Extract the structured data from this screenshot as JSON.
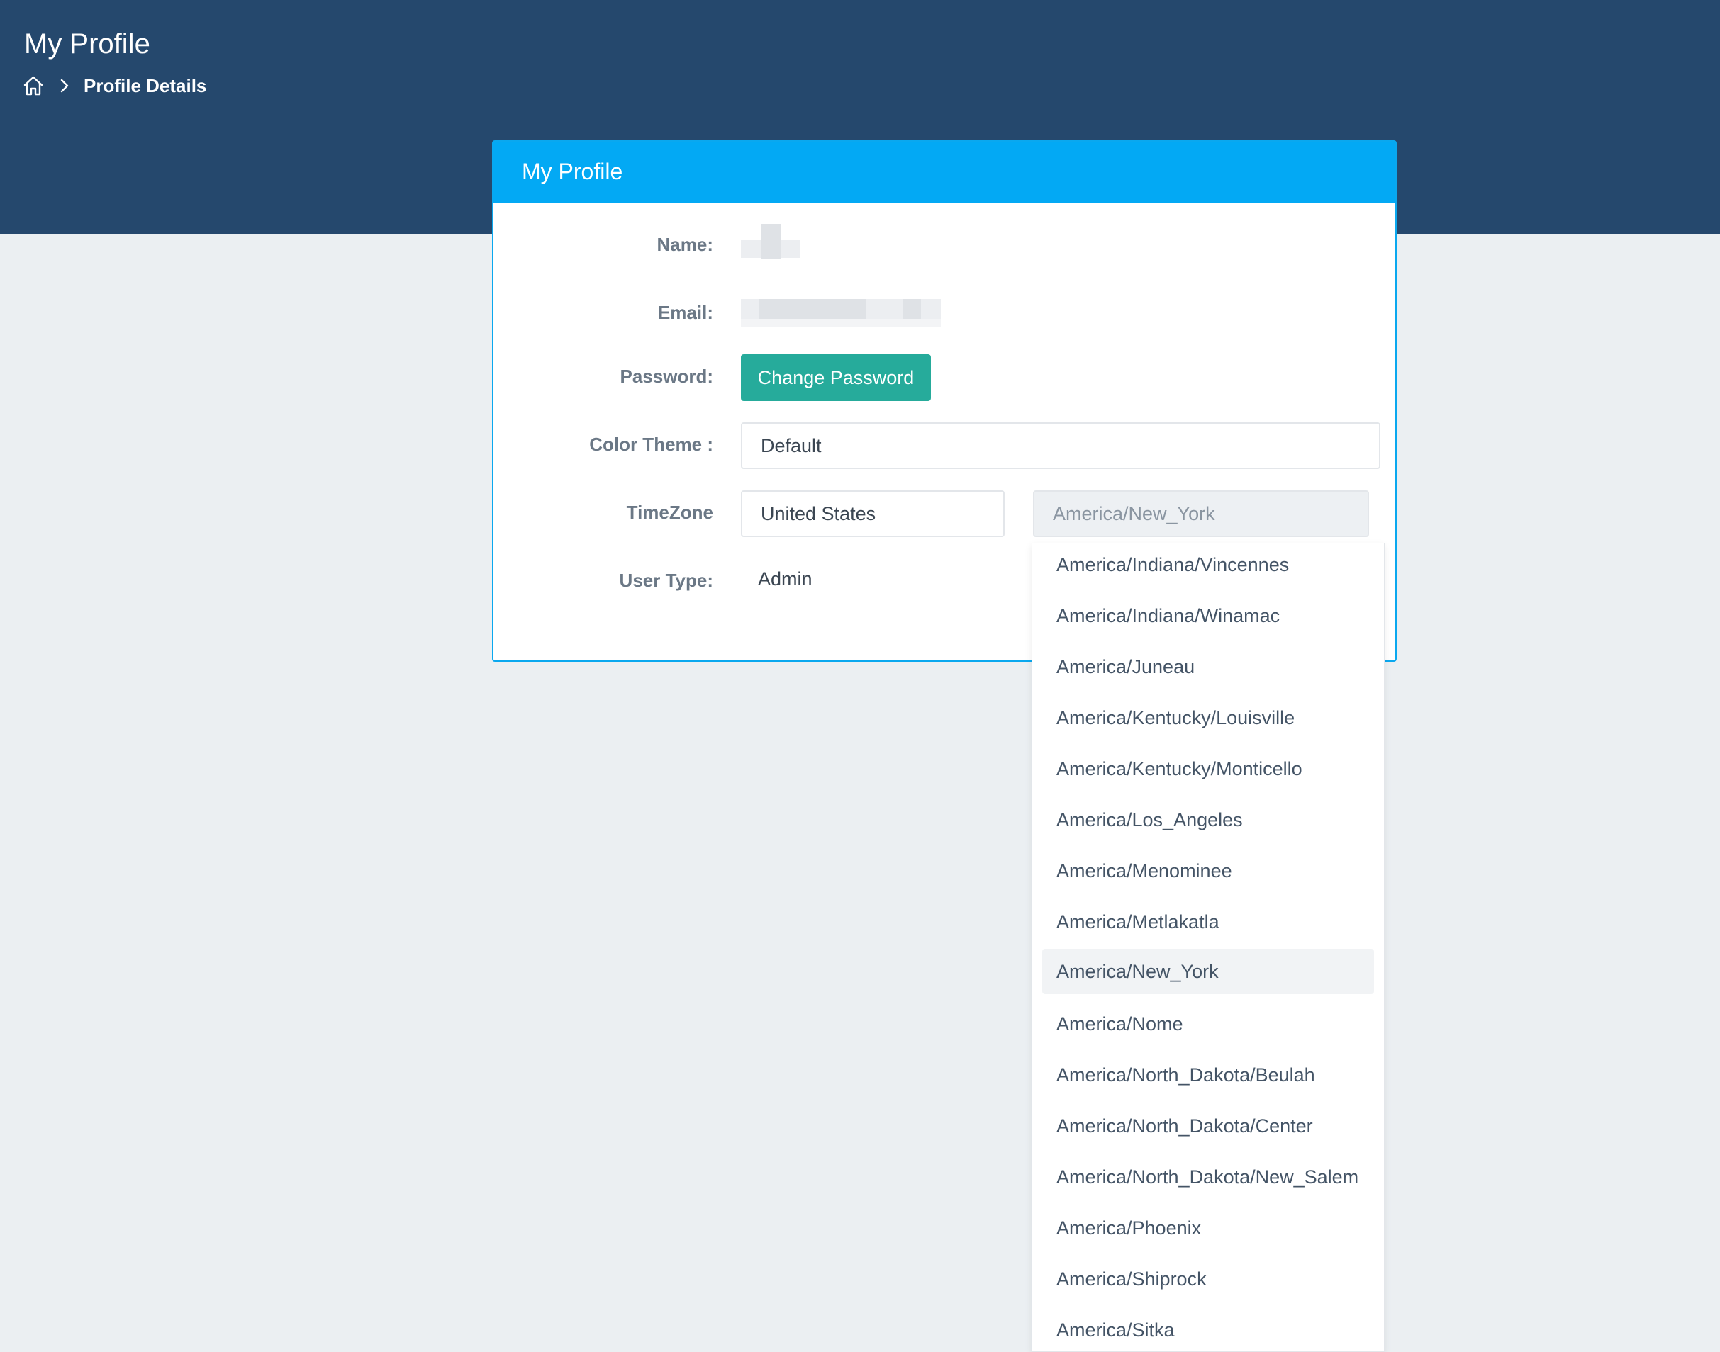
{
  "header": {
    "page_title": "My Profile",
    "breadcrumb_current": "Profile Details"
  },
  "card": {
    "title": "My Profile",
    "labels": {
      "name": "Name:",
      "email": "Email:",
      "password": "Password:",
      "color_theme": "Color Theme :",
      "timezone": "TimeZone",
      "user_type": "User Type:"
    },
    "change_password_label": "Change Password",
    "color_theme_value": "Default",
    "timezone_country": "United States",
    "timezone_zone": "America/New_York",
    "user_type_value": "Admin"
  },
  "timezone_dropdown": {
    "selected": "America/New_York",
    "options": [
      "America/Indiana/Vincennes",
      "America/Indiana/Winamac",
      "America/Juneau",
      "America/Kentucky/Louisville",
      "America/Kentucky/Monticello",
      "America/Los_Angeles",
      "America/Menominee",
      "America/Metlakatla",
      "America/New_York",
      "America/Nome",
      "America/North_Dakota/Beulah",
      "America/North_Dakota/Center",
      "America/North_Dakota/New_Salem",
      "America/Phoenix",
      "America/Shiprock",
      "America/Sitka"
    ]
  },
  "icons": {
    "home": "home-icon",
    "breadcrumb_separator": "chevron-right-icon"
  },
  "colors": {
    "header_band": "#25486d",
    "card_header": "#03a9f4",
    "primary_button": "#26ab9b",
    "page_background": "#ebeff2"
  }
}
